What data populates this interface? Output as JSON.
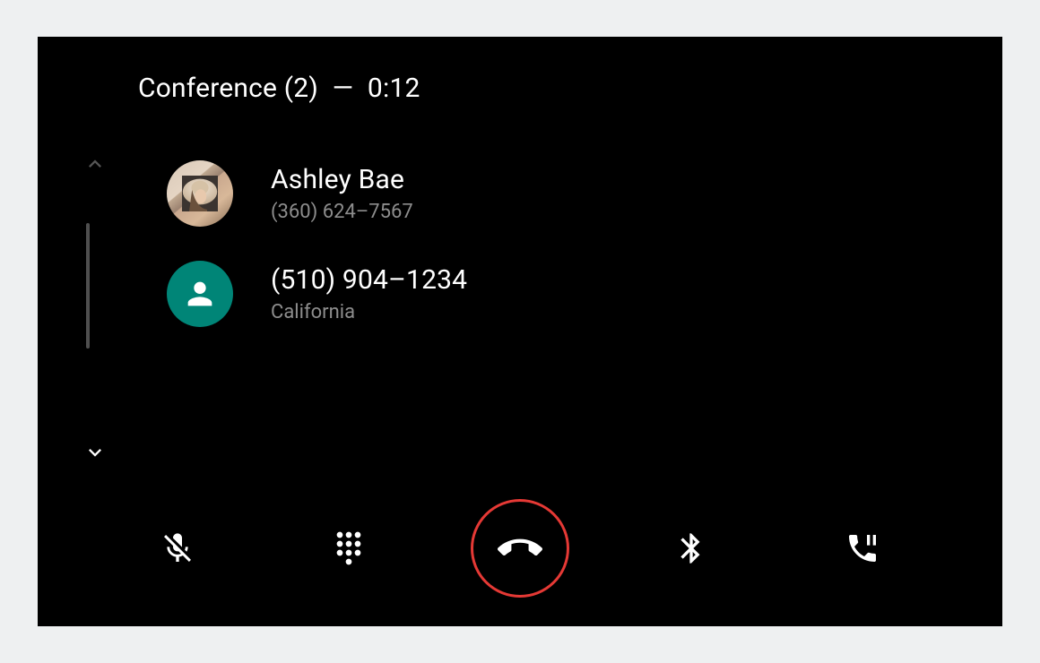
{
  "header": {
    "title": "Conference (2)",
    "separator": "—",
    "timer": "0:12"
  },
  "participants": [
    {
      "primary": "Ashley Bae",
      "secondary": "(360) 624–7567",
      "avatar_type": "photo"
    },
    {
      "primary": "(510) 904–1234",
      "secondary": "California",
      "avatar_type": "placeholder"
    }
  ],
  "controls": {
    "mute": "Mute",
    "dialpad": "Dialpad",
    "end": "End call",
    "bluetooth": "Bluetooth audio",
    "hold": "Hold call"
  },
  "colors": {
    "accent_red": "#e53935",
    "avatar_teal": "#008577"
  }
}
